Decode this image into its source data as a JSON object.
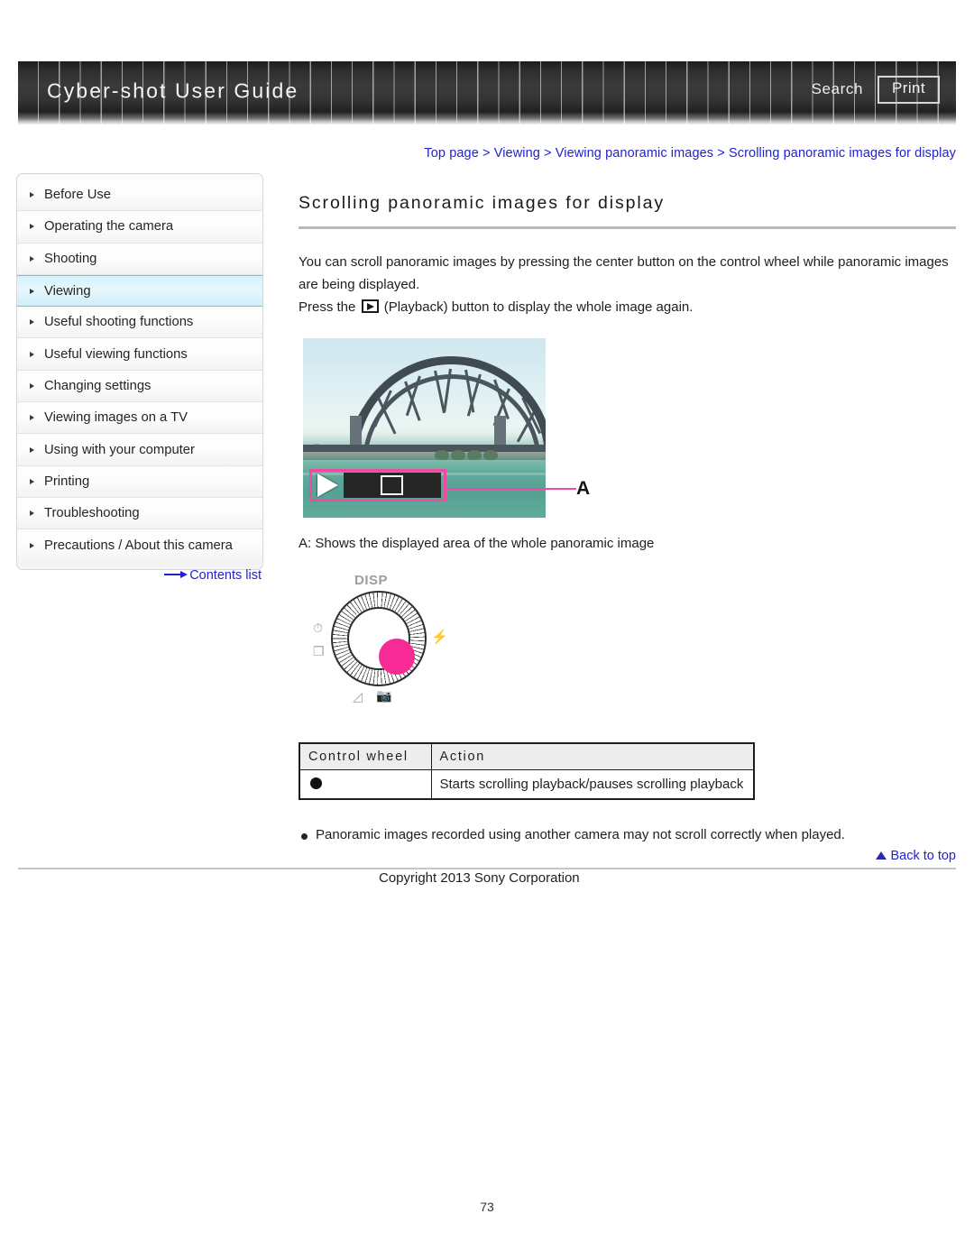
{
  "header": {
    "title": "Cyber-shot User Guide",
    "search_label": "Search",
    "print_label": "Print"
  },
  "breadcrumb": {
    "text": "Top page > Viewing > Viewing panoramic images > Scrolling panoramic images for display"
  },
  "sidebar": {
    "items": [
      {
        "label": "Before Use",
        "active": false
      },
      {
        "label": "Operating the camera",
        "active": false
      },
      {
        "label": "Shooting",
        "active": false
      },
      {
        "label": "Viewing",
        "active": true
      },
      {
        "label": "Useful shooting functions",
        "active": false
      },
      {
        "label": "Useful viewing functions",
        "active": false
      },
      {
        "label": "Changing settings",
        "active": false
      },
      {
        "label": "Viewing images on a TV",
        "active": false
      },
      {
        "label": "Using with your computer",
        "active": false
      },
      {
        "label": "Printing",
        "active": false
      },
      {
        "label": "Troubleshooting",
        "active": false
      },
      {
        "label": "Precautions / About this camera",
        "active": false
      }
    ],
    "contents_list_label": "Contents list"
  },
  "main": {
    "title": "Scrolling panoramic images for display",
    "paragraph1": "You can scroll panoramic images by pressing the center button on the control wheel while panoramic images are being displayed.",
    "paragraph2_before": "Press the",
    "paragraph2_after": "(Playback) button to display the whole image again.",
    "figure_label_a": "A",
    "figure_caption": "A: Shows the displayed area of the whole panoramic image",
    "control_wheel": {
      "disp_label": "DISP",
      "timer_icon": "self-timer-icon",
      "burst_icon": "burst-mode-icon",
      "flash_icon": "flash-icon",
      "ev_icon": "exposure-compensation-icon",
      "creative_icon": "photo-creativity-icon",
      "center_color": "#f72a96"
    },
    "table": {
      "headers": [
        "Control wheel",
        "Action"
      ],
      "rows": [
        {
          "control": "center-button-dot",
          "action": "Starts scrolling playback/pauses scrolling playback"
        }
      ]
    },
    "notes": [
      "Panoramic images recorded using another camera may not scroll correctly when played."
    ]
  },
  "footer": {
    "back_to_top_label": "Back to top",
    "copyright": "Copyright 2013 Sony Corporation",
    "page_number": "73"
  },
  "colors": {
    "link": "#2222cc",
    "accent_pink": "#ef4ba0",
    "active_nav": "#d4f2fb"
  }
}
